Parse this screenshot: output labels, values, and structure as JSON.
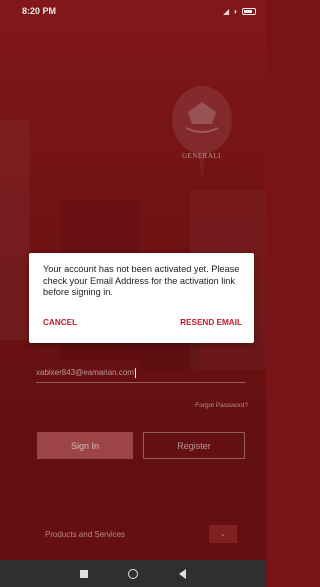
{
  "status_bar": {
    "time": "8:20 PM",
    "icons": [
      "signal-icon",
      "wifi-icon",
      "battery-icon"
    ]
  },
  "brand": {
    "logo_text": "GENERALI",
    "accent_color": "#c21b2e",
    "background_color": "#7c1416"
  },
  "login": {
    "email_value": "xabixer843@eamarian.com",
    "forgot_password": "Forgot Password?",
    "sign_in": "Sign In",
    "register": "Register",
    "products_select": "Products and Services"
  },
  "dialog": {
    "message": "Your account has not been activated yet. Please check your Email Address for the activation link before signing in.",
    "cancel": "CANCEL",
    "resend": "RESEND EMAIL"
  },
  "nav": {
    "buttons": [
      "recents-icon",
      "home-icon",
      "back-icon"
    ]
  }
}
